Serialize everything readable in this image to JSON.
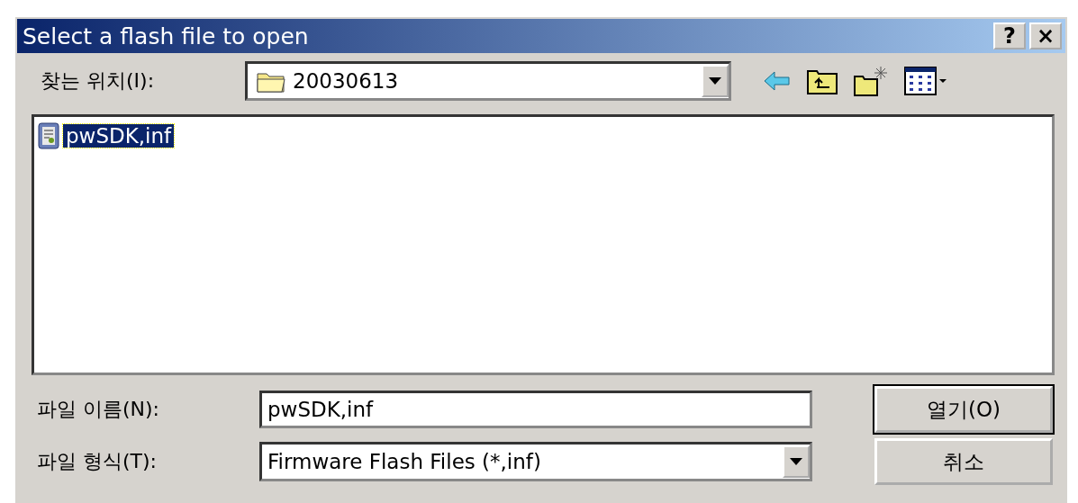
{
  "window": {
    "title": "Select a flash file to open",
    "title_buttons": [
      "?",
      "×"
    ]
  },
  "look_in": {
    "label": "찾는 위치(I):",
    "value": "20030613"
  },
  "files": [
    {
      "name": "pwSDK,inf",
      "selected": true
    }
  ],
  "file_name": {
    "label": "파일 이름(N):",
    "value": "pwSDK,inf"
  },
  "file_type": {
    "label": "파일 형식(T):",
    "value": "Firmware Flash Files (*,inf)"
  },
  "buttons": [
    "열기(O)",
    "취소"
  ]
}
